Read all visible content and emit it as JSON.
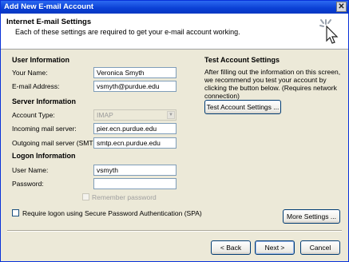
{
  "window": {
    "title": "Add New E-mail Account",
    "close_icon": "close-icon"
  },
  "header": {
    "title": "Internet E-mail Settings",
    "subtitle": "Each of these settings are required to get your e-mail account working.",
    "icon": "cursor-click-icon"
  },
  "user_info": {
    "heading": "User Information",
    "name_label": "Your Name:",
    "name_value": "Veronica Smyth",
    "email_label": "E-mail Address:",
    "email_value": "vsmyth@purdue.edu"
  },
  "server_info": {
    "heading": "Server Information",
    "account_type_label": "Account Type:",
    "account_type_value": "IMAP",
    "incoming_label": "Incoming mail server:",
    "incoming_value": "pier.ecn.purdue.edu",
    "outgoing_label": "Outgoing mail server (SMTP):",
    "outgoing_value": "smtp.ecn.purdue.edu"
  },
  "logon_info": {
    "heading": "Logon Information",
    "username_label": "User Name:",
    "username_value": "vsmyth",
    "password_label": "Password:",
    "password_value": "",
    "remember_label": "Remember password",
    "spa_label": "Require logon using Secure Password Authentication (SPA)"
  },
  "test": {
    "heading": "Test Account Settings",
    "description": "After filling out the information on this screen, we recommend you test your account by clicking the button below. (Requires network connection)",
    "button": "Test Account Settings ..."
  },
  "more_settings_button": "More Settings ...",
  "footer": {
    "back": "< Back",
    "next": "Next >",
    "cancel": "Cancel"
  }
}
